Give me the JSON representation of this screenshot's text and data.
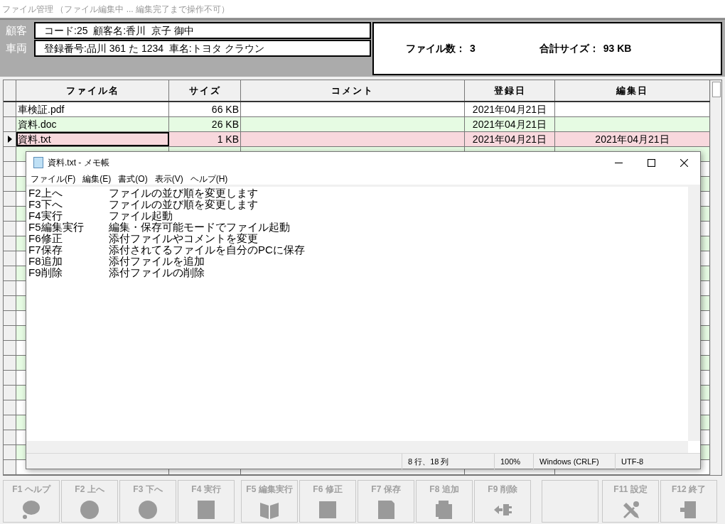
{
  "window": {
    "title": "ファイル管理 （ファイル編集中 ... 編集完了まで操作不可）"
  },
  "customer": {
    "label": "顧客",
    "text": "コード:25  顧客名:香川  京子 御中"
  },
  "vehicle": {
    "label": "車両",
    "text": "登録番号:品川 361 た 1234  車名:トヨタ クラウン"
  },
  "summary": {
    "file_count_label": "ファイル数：",
    "file_count": "3",
    "total_size_label": "合計サイズ：",
    "total_size": "93 KB"
  },
  "table": {
    "columns": [
      "ファイル名",
      "サイズ",
      "コメント",
      "登録日",
      "編集日"
    ],
    "rows": [
      {
        "cells": [
          "車検証.pdf",
          "66 KB",
          null,
          "2021年04月21日",
          null
        ],
        "selected": false
      },
      {
        "cells": [
          "資料.doc",
          "26 KB",
          null,
          "2021年04月21日",
          null
        ],
        "selected": false
      },
      {
        "cells": [
          "資料.txt",
          "1 KB",
          null,
          "2021年04月21日",
          "2021年04月21日"
        ],
        "selected": true
      }
    ]
  },
  "notepad": {
    "title": "資料.txt - メモ帳",
    "menu": [
      "ファイル(F)",
      "編集(E)",
      "書式(O)",
      "表示(V)",
      "ヘルプ(H)"
    ],
    "lines": [
      {
        "key": "F2上へ",
        "text": "ファイルの並び順を変更します"
      },
      {
        "key": "F3下へ",
        "text": "ファイルの並び順を変更します"
      },
      {
        "key": "F4実行",
        "text": "ファイル起動"
      },
      {
        "key": "F5編集実行",
        "text": "編集・保存可能モードでファイル起動"
      },
      {
        "key": "F6修正",
        "text": "添付ファイルやコメントを変更"
      },
      {
        "key": "F7保存",
        "text": "添付されてるファイルを自分のPCに保存"
      },
      {
        "key": "F8追加",
        "text": "添付ファイルを追加"
      },
      {
        "key": "F9削除",
        "text": "添付ファイルの削除"
      }
    ],
    "status": [
      "8 行、18 列",
      "100%",
      "Windows (CRLF)",
      "UTF-8"
    ]
  },
  "function_keys": [
    {
      "kind": "help",
      "label": "F1 ヘルプ",
      "disabled": true
    },
    {
      "kind": "up",
      "label": "F2 上へ",
      "disabled": true
    },
    {
      "kind": "down",
      "label": "F3 下へ",
      "disabled": true
    },
    {
      "kind": "run",
      "label": "F4 実行",
      "disabled": true
    },
    {
      "kind": "edit",
      "label": "F5 編集実行",
      "disabled": true
    },
    {
      "kind": "modify",
      "label": "F6 修正",
      "disabled": true
    },
    {
      "kind": "save",
      "label": "F7 保存",
      "disabled": true
    },
    {
      "kind": "add",
      "label": "F8 追加",
      "disabled": true
    },
    {
      "kind": "delete",
      "label": "F9 削除",
      "disabled": true
    },
    {
      "kind": "blank"
    },
    {
      "kind": "settings",
      "label": "F11 設定",
      "disabled": true
    },
    {
      "kind": "exit",
      "label": "F12 終了",
      "disabled": true
    }
  ]
}
